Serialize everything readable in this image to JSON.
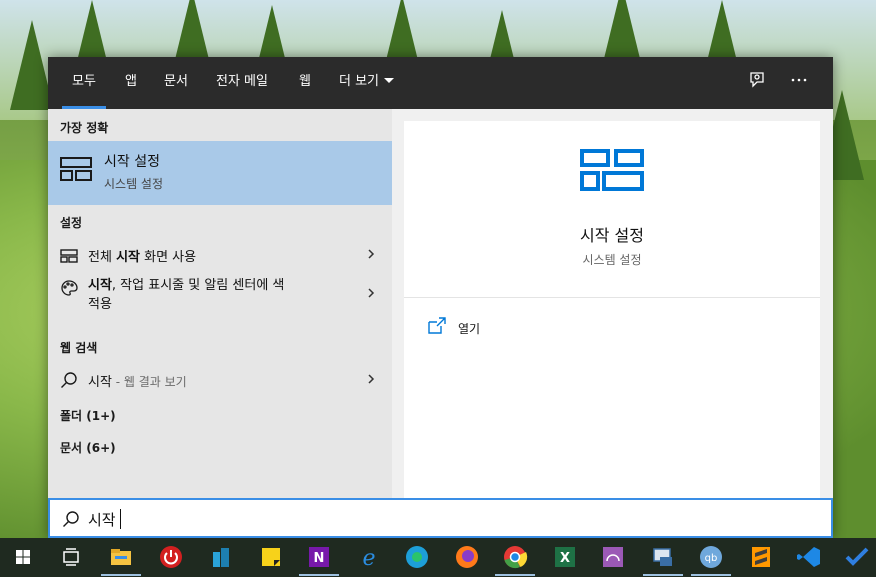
{
  "tabs": [
    {
      "label": "모두"
    },
    {
      "label": "앱"
    },
    {
      "label": "문서"
    },
    {
      "label": "전자 메일"
    },
    {
      "label": "웹"
    },
    {
      "label": "더 보기"
    }
  ],
  "sections": {
    "best_match": "가장 정확",
    "settings": "설정",
    "web_search": "웹 검색",
    "folders": "폴더 (1+)",
    "documents": "문서 (6+)"
  },
  "best_match": {
    "title": "시작 설정",
    "subtitle": "시스템 설정"
  },
  "settings_items": [
    {
      "pre": "전체 ",
      "bold": "시작",
      "post": " 화면 사용"
    },
    {
      "pre": "",
      "bold": "시작",
      "post": ", 작업 표시줄 및 알림 센터에 색",
      "line2": "적용"
    }
  ],
  "web_item": {
    "query": "시작",
    "hint": " - 웹 결과 보기"
  },
  "preview": {
    "title": "시작 설정",
    "subtitle": "시스템 설정",
    "action": "열기"
  },
  "search": {
    "value": "시작"
  },
  "colors": {
    "accent": "#3a8ee6",
    "selected_row": "#a9c9e8",
    "topbar": "#2b2b2b",
    "icon_blue": "#0078d7"
  },
  "taskbar_icons": [
    "windows-start-icon",
    "task-view-icon",
    "file-explorer-icon",
    "power-app-icon",
    "buildings-app-icon",
    "sticky-notes-icon",
    "onenote-icon",
    "internet-explorer-icon",
    "edge-icon",
    "firefox-icon",
    "chrome-icon",
    "excel-icon",
    "gauge-app-icon",
    "remote-desktop-icon",
    "qbittorrent-icon",
    "sublime-text-icon",
    "vscode-icon",
    "todo-icon"
  ]
}
